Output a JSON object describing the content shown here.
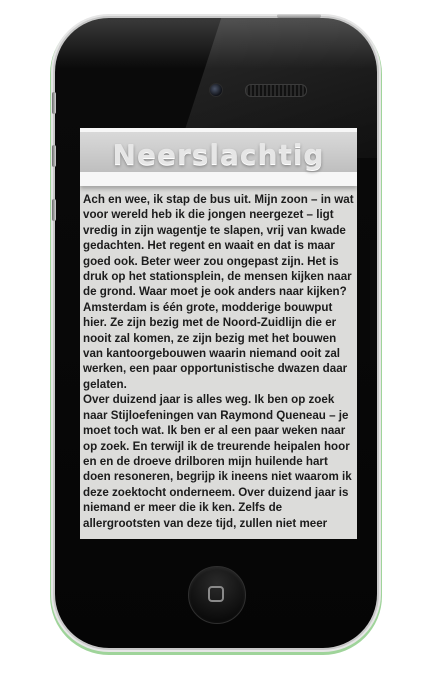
{
  "app": {
    "title": "Neerslachtig"
  },
  "article": {
    "paragraphs": [
      "Ach en wee, ik stap de bus uit. Mijn zoon – in wat voor wereld heb ik die jongen neergezet – ligt vredig in zijn wagentje te slapen, vrij van kwade gedachten. Het regent en waait en dat is maar goed ook. Beter weer zou ongepast zijn. Het is druk op het stationsplein, de mensen kijken naar de grond. Waar moet je ook anders naar kijken? Amsterdam is één grote, modderige bouwput hier. Ze zijn bezig met de Noord-Zuidlijn die er nooit zal komen, ze zijn bezig met het bouwen van kantoorgebouwen waarin niemand ooit zal werken, een paar opportunistische dwazen daar gelaten.",
      "Over duizend jaar is alles weg. Ik ben op zoek naar Stijloefeningen van Raymond Queneau – je moet toch wat. Ik ben er al een paar weken naar op zoek. En terwijl ik de treurende heipalen hoor en en de droeve drilboren mijn huilende hart doen resoneren, begrijp ik ineens niet waarom ik deze zoektocht onderneem. Over duizend jaar is niemand er meer die ik ken. Zelfs de allergrootsten van deze tijd, zullen niet meer"
    ]
  },
  "colors": {
    "screen_background": "#dcdcda",
    "text": "#1c1c1c",
    "title_text": "#e6e6e6",
    "phone_body": "#050505",
    "phone_edge_glow": "#9fd49a"
  },
  "icons": {
    "home_button": "rounded-square-icon",
    "camera": "camera-icon",
    "speaker": "speaker-grille-icon"
  }
}
